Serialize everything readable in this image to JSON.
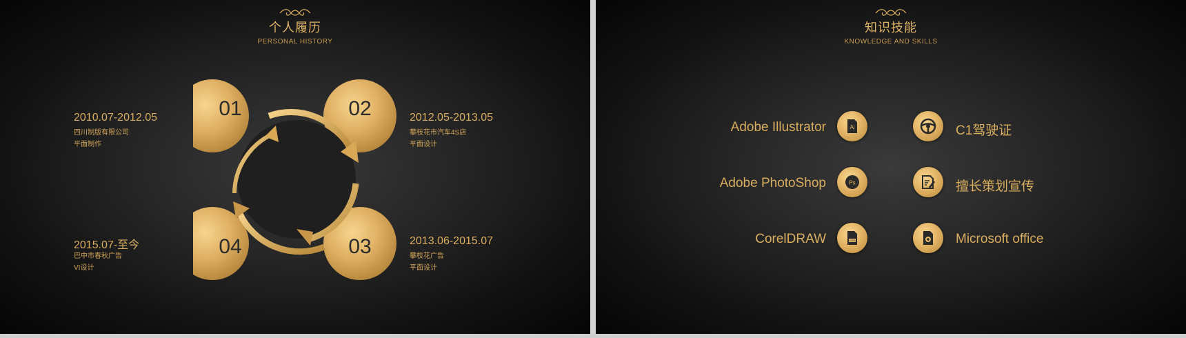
{
  "left": {
    "title": "个人履历",
    "subtitle": "PERSONAL HISTORY",
    "entries": [
      {
        "num": "01",
        "date": "2010.07-2012.05",
        "line1": "四川制版有限公司",
        "line2": "平面制作"
      },
      {
        "num": "02",
        "date": "2012.05-2013.05",
        "line1": "攀枝花市汽车4S店",
        "line2": "平面设计"
      },
      {
        "num": "03",
        "date": "2013.06-2015.07",
        "line1": "攀枝花广告",
        "line2": "平面设计"
      },
      {
        "num": "04",
        "date": "2015.07-至今",
        "line1": "巴中市春秋广告",
        "line2": "VI设计"
      }
    ]
  },
  "right": {
    "title": "知识技能",
    "subtitle": "KNOWLEDGE AND SKILLS",
    "skills_left": [
      {
        "label": "Adobe Illustrator",
        "icon": "illustrator-icon",
        "glyph": "Ai"
      },
      {
        "label": "Adobe PhotoShop",
        "icon": "photoshop-icon",
        "glyph": "Ps"
      },
      {
        "label": "CorelDRAW",
        "icon": "coreldraw-icon",
        "glyph": "CDR"
      }
    ],
    "skills_right": [
      {
        "label": "C1驾驶证",
        "icon": "steering-wheel-icon"
      },
      {
        "label": "擅长策划宣传",
        "icon": "document-edit-icon"
      },
      {
        "label": "Microsoft office",
        "icon": "office-icon"
      }
    ]
  },
  "colors": {
    "gold": "#d9ad5f",
    "gold_light": "#f2cf83",
    "background": "#1a1a1a"
  }
}
